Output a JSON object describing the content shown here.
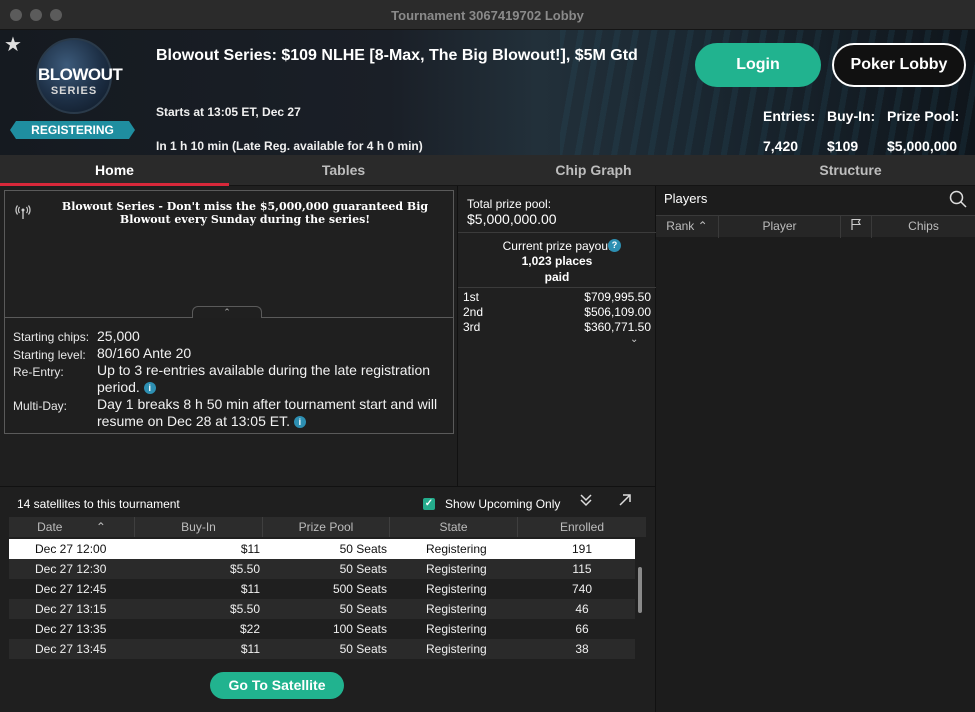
{
  "window": {
    "title": "Tournament 3067419702 Lobby"
  },
  "header": {
    "logo_line1": "BLOWOUT",
    "logo_line2": "SERIES",
    "status_badge": "REGISTERING",
    "title": "Blowout Series: $109 NLHE [8-Max, The Big Blowout!], $5M Gtd",
    "starts": "Starts at 13:05 ET, Dec 27",
    "countdown": "In 1 h 10 min (Late Reg. available for 4 h 0 min)",
    "login_label": "Login",
    "lobby_label": "Poker Lobby",
    "stats": {
      "entries_label": "Entries:",
      "entries_value": "7,420",
      "buyin_label": "Buy-In:",
      "buyin_value": "$109",
      "prizepool_label": "Prize Pool:",
      "prizepool_value": "$5,000,000"
    }
  },
  "tabs": [
    {
      "label": "Home",
      "active": true
    },
    {
      "label": "Tables"
    },
    {
      "label": "Chip Graph"
    },
    {
      "label": "Structure"
    }
  ],
  "info": {
    "promo": "Blowout Series - Don't miss the $5,000,000 guaranteed Big Blowout every Sunday during the series!",
    "details": [
      {
        "label": "Starting chips:",
        "value": "25,000"
      },
      {
        "label": "Starting level:",
        "value": "80/160 Ante 20"
      },
      {
        "label": "Re-Entry:",
        "value": "Up to 3 re-entries available during the late registration period."
      },
      {
        "label": "Multi-Day:",
        "value": "Day 1 breaks 8 h 50 min after tournament start and will resume on Dec 28 at 13:05 ET."
      }
    ]
  },
  "prize": {
    "total_label": "Total prize pool:",
    "total_value": "$5,000,000.00",
    "payout_title": "Current prize payout",
    "places": "1,023 places",
    "paid": "paid",
    "rows": [
      {
        "place": "1st",
        "amount": "$709,995.50"
      },
      {
        "place": "2nd",
        "amount": "$506,109.00"
      },
      {
        "place": "3rd",
        "amount": "$360,771.50"
      }
    ]
  },
  "players": {
    "title": "Players",
    "columns": [
      "Rank",
      "Player",
      "",
      "Chips"
    ]
  },
  "satellites": {
    "title": "14 satellites to this tournament",
    "show_upcoming_label": "Show Upcoming Only",
    "show_upcoming_checked": true,
    "columns": [
      "Date",
      "Buy-In",
      "Prize Pool",
      "State",
      "Enrolled"
    ],
    "rows": [
      {
        "date": "Dec 27  12:00",
        "buyin": "$11",
        "prize": "50 Seats",
        "state": "Registering",
        "enrolled": "191"
      },
      {
        "date": "Dec 27  12:30",
        "buyin": "$5.50",
        "prize": "50 Seats",
        "state": "Registering",
        "enrolled": "115"
      },
      {
        "date": "Dec 27  12:45",
        "buyin": "$11",
        "prize": "500 Seats",
        "state": "Registering",
        "enrolled": "740"
      },
      {
        "date": "Dec 27  13:15",
        "buyin": "$5.50",
        "prize": "50 Seats",
        "state": "Registering",
        "enrolled": "46"
      },
      {
        "date": "Dec 27  13:35",
        "buyin": "$22",
        "prize": "100 Seats",
        "state": "Registering",
        "enrolled": "66"
      },
      {
        "date": "Dec 27  13:45",
        "buyin": "$11",
        "prize": "50 Seats",
        "state": "Registering",
        "enrolled": "38"
      }
    ],
    "button_label": "Go To Satellite"
  },
  "colors": {
    "accent": "#21b38f",
    "tab_underline": "#d8283a",
    "badge": "#1f8ea0",
    "info_icon": "#2d8fb2"
  }
}
